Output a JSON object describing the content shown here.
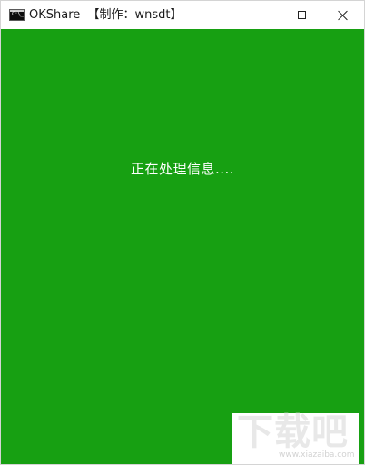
{
  "window": {
    "title": "OKShare  【制作：wnsdt】",
    "icon": "cmd-console-icon",
    "icon_prompt": "C:\\_",
    "controls": {
      "minimize": "minimize-icon",
      "maximize": "maximize-icon",
      "close": "close-icon"
    }
  },
  "console": {
    "background_color": "#17a012",
    "text_color": "#ffffff",
    "status_text": "正在处理信息...."
  },
  "watermark": {
    "logo_text": "下载吧",
    "url_text": "www.xiazaiba.com"
  }
}
